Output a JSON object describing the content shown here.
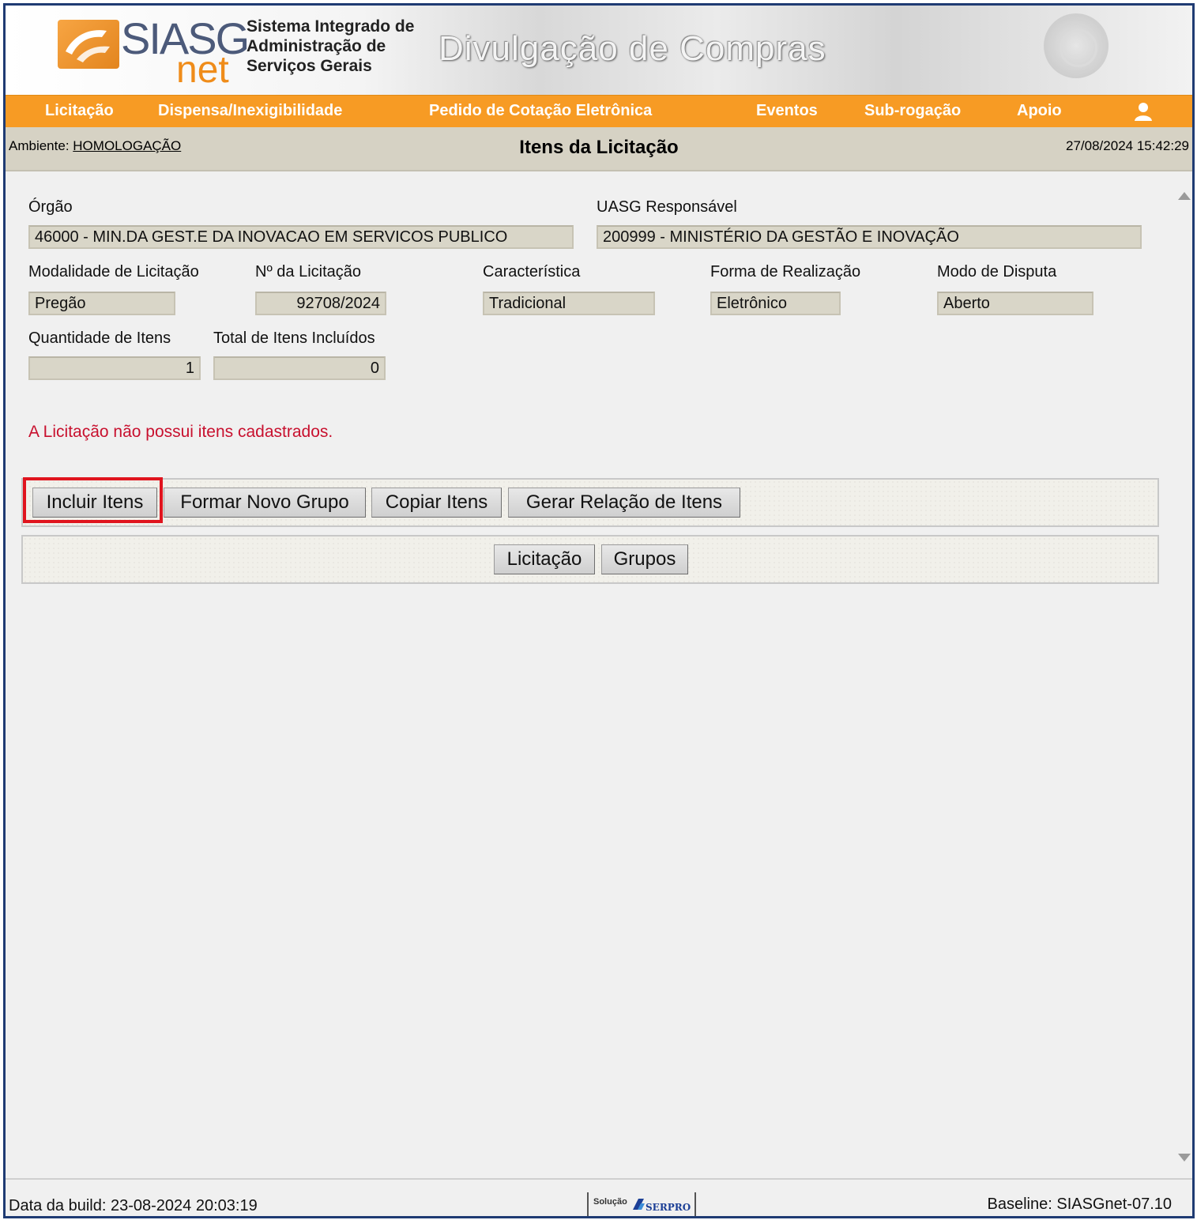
{
  "header": {
    "logo_main": "SIASG",
    "logo_sub": "net",
    "logo_text_lines": [
      "Sistema Integrado de",
      "Administração de",
      "Serviços Gerais"
    ],
    "banner_title": "Divulgação de Compras",
    "seal_icon": "brazil-coat-of-arms-icon"
  },
  "menu": {
    "items": [
      "Licitação",
      "Dispensa/Inexigibilidade",
      "Pedido de Cotação Eletrônica",
      "Eventos",
      "Sub-rogação",
      "Apoio"
    ],
    "user_icon": "user-icon",
    "accent_color": "#f79b24"
  },
  "titlebar": {
    "env_label": "Ambiente:",
    "env_value": "HOMOLOGAÇÃO",
    "page_title": "Itens da Licitação",
    "datetime": "27/08/2024 15:42:29"
  },
  "form": {
    "orgao_label": "Órgão",
    "orgao_value": "46000 - MIN.DA GEST.E DA INOVACAO EM SERVICOS PUBLICO",
    "uasg_label": "UASG Responsável",
    "uasg_value": "200999 - MINISTÉRIO DA GESTÃO E INOVAÇÃO",
    "modalidade_label": "Modalidade de Licitação",
    "modalidade_value": "Pregão",
    "numero_label": "Nº da Licitação",
    "numero_value": "92708/2024",
    "caracteristica_label": "Característica",
    "caracteristica_value": "Tradicional",
    "forma_label": "Forma de Realização",
    "forma_value": "Eletrônico",
    "modo_label": "Modo de Disputa",
    "modo_value": "Aberto",
    "quantidade_label": "Quantidade de Itens",
    "quantidade_value": "1",
    "total_label": "Total de Itens Incluídos",
    "total_value": "0"
  },
  "alert": {
    "message": "A Licitação não possui itens cadastrados.",
    "color": "#c8102e"
  },
  "actions": {
    "incluir": "Incluir Itens",
    "formar": "Formar Novo Grupo",
    "copiar": "Copiar Itens",
    "gerar": "Gerar Relação de Itens",
    "highlight_color": "#e0141e"
  },
  "nav": {
    "licitacao": "Licitação",
    "grupos": "Grupos"
  },
  "footer": {
    "build": "Data da build: 23-08-2024 20:03:19",
    "serpro_prefix": "Solução",
    "serpro_name": "SERPRO",
    "baseline": "Baseline: SIASGnet-07.10"
  }
}
